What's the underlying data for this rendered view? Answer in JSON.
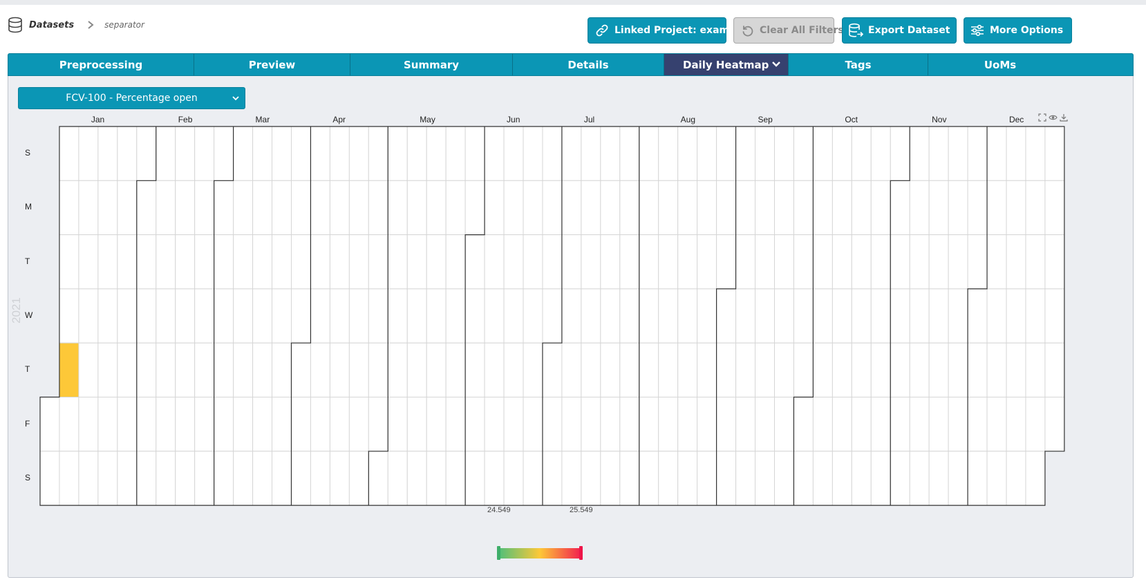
{
  "breadcrumb": {
    "root": "Datasets",
    "leaf": "separator"
  },
  "toolbar": {
    "linked_project": "Linked Project: example",
    "clear_filters": "Clear All Filters",
    "export_dataset": "Export Dataset",
    "more_options": "More Options"
  },
  "tabs": [
    "Preprocessing",
    "Preview",
    "Summary",
    "Details",
    "Daily Heatmap",
    "Tags",
    "UoMs"
  ],
  "active_tab": "Daily Heatmap",
  "series_select": {
    "value": "FCV-100 - Percentage open"
  },
  "colors": {
    "accent": "#0b96b5",
    "active_tab": "#36416f",
    "cell_value": "#fecb38",
    "scale_low": "#4fbf7a",
    "scale_mid": "#fdc838",
    "scale_high": "#f21e4e"
  },
  "chart_data": {
    "type": "heatmap",
    "year_label": "2021",
    "weekdays": [
      "S",
      "M",
      "T",
      "W",
      "T",
      "F",
      "S"
    ],
    "months": [
      "Jan",
      "Feb",
      "Mar",
      "Apr",
      "May",
      "Jun",
      "Jul",
      "Aug",
      "Sep",
      "Oct",
      "Nov",
      "Dec"
    ],
    "start_date": "2021-01-01",
    "end_date": "2021-12-31",
    "values": [
      {
        "date": "2021-01-07",
        "value": 25.05
      }
    ],
    "color_scale": {
      "min": 24.549,
      "max": 25.549,
      "min_label": "24.549",
      "max_label": "25.549"
    }
  }
}
